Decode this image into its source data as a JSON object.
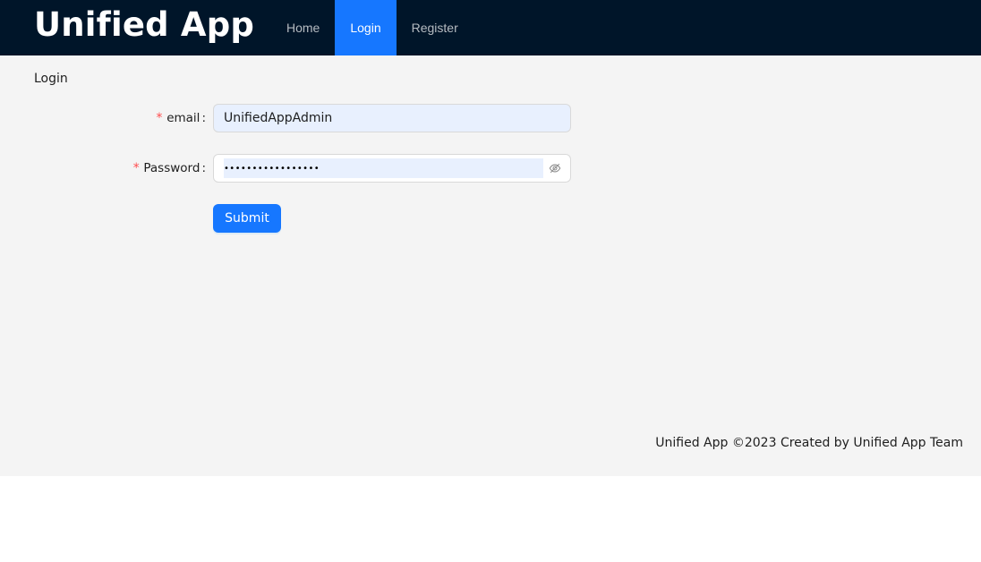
{
  "header": {
    "app_title": "Unified App",
    "nav": [
      {
        "label": "Home",
        "active": false
      },
      {
        "label": "Login",
        "active": true
      },
      {
        "label": "Register",
        "active": false
      }
    ]
  },
  "breadcrumb": "Login",
  "form": {
    "email": {
      "required_mark": "*",
      "label": "email",
      "colon": ":",
      "value": "UnifiedAppAdmin"
    },
    "password": {
      "required_mark": "*",
      "label": "Password",
      "colon": ":",
      "masked_value": "•••••••••••••••••",
      "toggle_icon": "eye-invisible-icon"
    },
    "submit_label": "Submit"
  },
  "footer": {
    "text": "Unified App ©2023 Created by Unified App Team"
  },
  "colors": {
    "header_bg": "#001529",
    "accent": "#1677ff",
    "content_bg": "#f4f4f4",
    "required": "#ff4d4f",
    "autofill_bg": "#e8f0fe"
  }
}
